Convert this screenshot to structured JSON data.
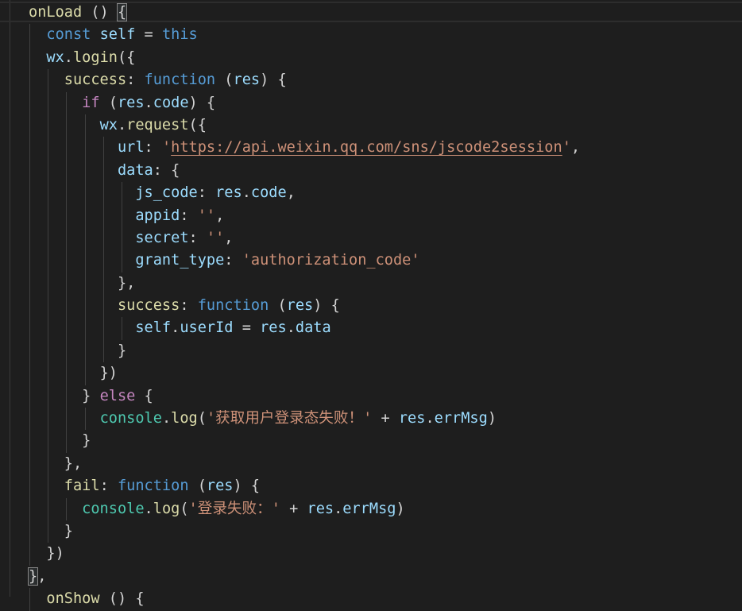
{
  "editor": {
    "language": "javascript",
    "lines": [
      {
        "indent": 0,
        "tokens": [
          [
            "fn",
            "onLoad"
          ],
          [
            "pun",
            " () "
          ],
          [
            "match",
            "{"
          ]
        ]
      },
      {
        "indent": 1,
        "tokens": [
          [
            "kw",
            "const"
          ],
          [
            "pun",
            " "
          ],
          [
            "var",
            "self"
          ],
          [
            "pun",
            " = "
          ],
          [
            "kw",
            "this"
          ]
        ]
      },
      {
        "indent": 1,
        "tokens": [
          [
            "var",
            "wx"
          ],
          [
            "pun",
            "."
          ],
          [
            "fn",
            "login"
          ],
          [
            "pun",
            "({"
          ]
        ]
      },
      {
        "indent": 2,
        "tokens": [
          [
            "fn",
            "success"
          ],
          [
            "pun",
            ": "
          ],
          [
            "kw",
            "function"
          ],
          [
            "pun",
            " ("
          ],
          [
            "var",
            "res"
          ],
          [
            "pun",
            ") {"
          ]
        ]
      },
      {
        "indent": 3,
        "tokens": [
          [
            "ctrl",
            "if"
          ],
          [
            "pun",
            " ("
          ],
          [
            "var",
            "res"
          ],
          [
            "pun",
            "."
          ],
          [
            "var",
            "code"
          ],
          [
            "pun",
            ") {"
          ]
        ]
      },
      {
        "indent": 4,
        "tokens": [
          [
            "var",
            "wx"
          ],
          [
            "pun",
            "."
          ],
          [
            "fn",
            "request"
          ],
          [
            "pun",
            "({"
          ]
        ]
      },
      {
        "indent": 5,
        "tokens": [
          [
            "prop",
            "url"
          ],
          [
            "pun",
            ": "
          ],
          [
            "str",
            "'"
          ],
          [
            "link",
            "https://api.weixin.qq.com/sns/jscode2session"
          ],
          [
            "str",
            "'"
          ],
          [
            "pun",
            ","
          ]
        ]
      },
      {
        "indent": 5,
        "tokens": [
          [
            "prop",
            "data"
          ],
          [
            "pun",
            ": {"
          ]
        ]
      },
      {
        "indent": 6,
        "tokens": [
          [
            "prop",
            "js_code"
          ],
          [
            "pun",
            ": "
          ],
          [
            "var",
            "res"
          ],
          [
            "pun",
            "."
          ],
          [
            "var",
            "code"
          ],
          [
            "pun",
            ","
          ]
        ]
      },
      {
        "indent": 6,
        "tokens": [
          [
            "prop",
            "appid"
          ],
          [
            "pun",
            ": "
          ],
          [
            "str",
            "''"
          ],
          [
            "pun",
            ","
          ]
        ]
      },
      {
        "indent": 6,
        "tokens": [
          [
            "prop",
            "secret"
          ],
          [
            "pun",
            ": "
          ],
          [
            "str",
            "''"
          ],
          [
            "pun",
            ","
          ]
        ]
      },
      {
        "indent": 6,
        "tokens": [
          [
            "prop",
            "grant_type"
          ],
          [
            "pun",
            ": "
          ],
          [
            "str",
            "'authorization_code'"
          ]
        ]
      },
      {
        "indent": 5,
        "tokens": [
          [
            "pun",
            "},"
          ]
        ]
      },
      {
        "indent": 5,
        "tokens": [
          [
            "fn",
            "success"
          ],
          [
            "pun",
            ": "
          ],
          [
            "kw",
            "function"
          ],
          [
            "pun",
            " ("
          ],
          [
            "var",
            "res"
          ],
          [
            "pun",
            ") {"
          ]
        ]
      },
      {
        "indent": 6,
        "tokens": [
          [
            "var",
            "self"
          ],
          [
            "pun",
            "."
          ],
          [
            "var",
            "userId"
          ],
          [
            "pun",
            " = "
          ],
          [
            "var",
            "res"
          ],
          [
            "pun",
            "."
          ],
          [
            "var",
            "data"
          ]
        ]
      },
      {
        "indent": 5,
        "tokens": [
          [
            "pun",
            "}"
          ]
        ]
      },
      {
        "indent": 4,
        "tokens": [
          [
            "pun",
            "})"
          ]
        ]
      },
      {
        "indent": 3,
        "tokens": [
          [
            "pun",
            "} "
          ],
          [
            "ctrl",
            "else"
          ],
          [
            "pun",
            " {"
          ]
        ]
      },
      {
        "indent": 4,
        "tokens": [
          [
            "obj",
            "console"
          ],
          [
            "pun",
            "."
          ],
          [
            "fn",
            "log"
          ],
          [
            "pun",
            "("
          ],
          [
            "str",
            "'获取用户登录态失败！'"
          ],
          [
            "pun",
            " + "
          ],
          [
            "var",
            "res"
          ],
          [
            "pun",
            "."
          ],
          [
            "var",
            "errMsg"
          ],
          [
            "pun",
            ")"
          ]
        ]
      },
      {
        "indent": 3,
        "tokens": [
          [
            "pun",
            "}"
          ]
        ]
      },
      {
        "indent": 2,
        "tokens": [
          [
            "pun",
            "},"
          ]
        ]
      },
      {
        "indent": 2,
        "tokens": [
          [
            "fn",
            "fail"
          ],
          [
            "pun",
            ": "
          ],
          [
            "kw",
            "function"
          ],
          [
            "pun",
            " ("
          ],
          [
            "var",
            "res"
          ],
          [
            "pun",
            ") {"
          ]
        ]
      },
      {
        "indent": 3,
        "tokens": [
          [
            "obj",
            "console"
          ],
          [
            "pun",
            "."
          ],
          [
            "fn",
            "log"
          ],
          [
            "pun",
            "("
          ],
          [
            "str",
            "'登录失败：'"
          ],
          [
            "pun",
            " + "
          ],
          [
            "var",
            "res"
          ],
          [
            "pun",
            "."
          ],
          [
            "var",
            "errMsg"
          ],
          [
            "pun",
            ")"
          ]
        ]
      },
      {
        "indent": 2,
        "tokens": [
          [
            "pun",
            "}"
          ]
        ]
      },
      {
        "indent": 1,
        "tokens": [
          [
            "pun",
            "})"
          ]
        ]
      },
      {
        "indent": 0,
        "tokens": [
          [
            "match",
            "}"
          ],
          [
            "pun",
            ","
          ]
        ]
      },
      {
        "indent": 1,
        "tokens": [
          [
            "fn",
            "onShow"
          ],
          [
            "pun",
            " () {"
          ]
        ]
      }
    ]
  }
}
